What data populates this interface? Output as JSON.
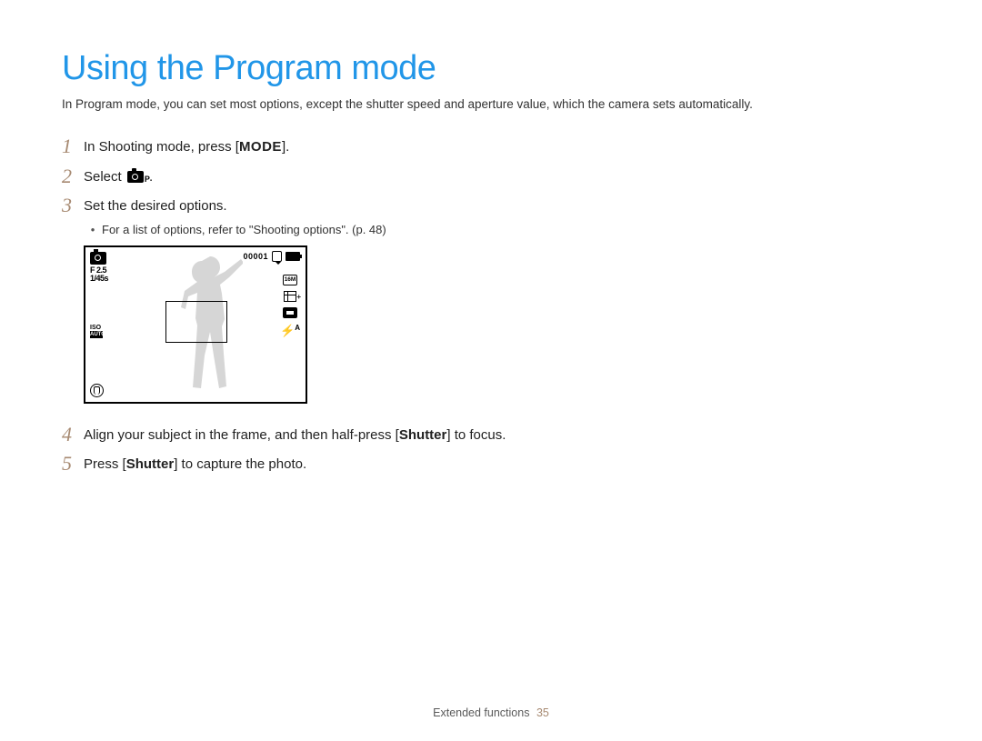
{
  "title": "Using the Program mode",
  "intro": "In Program mode, you can set most options, except the shutter speed and aperture value, which the camera sets automatically.",
  "steps": {
    "s1": {
      "num": "1",
      "text_a": "In Shooting mode, press [",
      "mode": "MODE",
      "text_b": "]."
    },
    "s2": {
      "num": "2",
      "text_a": "Select ",
      "text_b": "."
    },
    "s3": {
      "num": "3",
      "text": "Set the desired options.",
      "sub": "For a list of options, refer to \"Shooting options\". (p. 48)"
    },
    "s4": {
      "num": "4",
      "text_a": "Align your subject in the frame, and then half-press [",
      "shutter": "Shutter",
      "text_b": "] to focus."
    },
    "s5": {
      "num": "5",
      "text_a": "Press [",
      "shutter": "Shutter",
      "text_b": "] to capture the photo."
    }
  },
  "camera_screen": {
    "aperture": "F 2.5",
    "shutter_speed": "1/45s",
    "iso_label": "ISO",
    "iso_value": "AUTO",
    "counter": "00001",
    "resolution": "16M",
    "flash": "A"
  },
  "footer": {
    "section": "Extended functions",
    "page": "35"
  }
}
